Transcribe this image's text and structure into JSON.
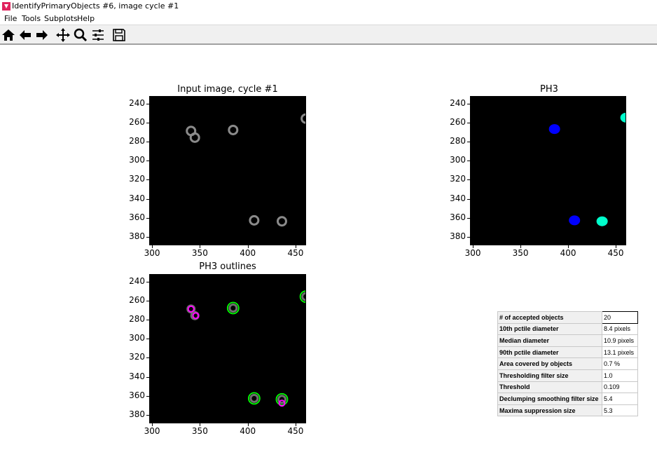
{
  "window": {
    "title": "IdentifyPrimaryObjects #6, image cycle #1"
  },
  "menu": [
    "File",
    "Tools",
    "Subplots",
    "Help"
  ],
  "toolbar": [
    {
      "name": "home-icon"
    },
    {
      "name": "back-arrow-icon"
    },
    {
      "name": "forward-arrow-icon"
    },
    {
      "name": "pan-icon"
    },
    {
      "name": "zoom-icon"
    },
    {
      "name": "configure-subplots-icon"
    },
    {
      "name": "save-icon"
    }
  ],
  "plots": [
    {
      "id": "input",
      "title": "Input image, cycle #1"
    },
    {
      "id": "ph3",
      "title": "PH3"
    },
    {
      "id": "outlines",
      "title": "PH3 outlines"
    }
  ],
  "axes": {
    "xticks": [
      "300",
      "350",
      "400",
      "450"
    ],
    "yticks": [
      "240",
      "260",
      "280",
      "300",
      "320",
      "340",
      "360",
      "380"
    ],
    "xlim": [
      297,
      461
    ],
    "ylim": [
      389,
      232
    ]
  },
  "objects": {
    "gray_cells": [
      {
        "x": 340,
        "y": 268
      },
      {
        "x": 344,
        "y": 275
      },
      {
        "x": 384,
        "y": 267
      },
      {
        "x": 406,
        "y": 362
      },
      {
        "x": 435,
        "y": 363
      },
      {
        "x": 460,
        "y": 255
      }
    ],
    "ph3_labels": [
      {
        "x": 385,
        "y": 266,
        "color": "#0000ff"
      },
      {
        "x": 406,
        "y": 362,
        "color": "#0000ff"
      },
      {
        "x": 435,
        "y": 363,
        "color": "#00ffcc"
      },
      {
        "x": 460,
        "y": 254,
        "color": "#00ffcc"
      }
    ],
    "outlines_green": [
      {
        "x": 384,
        "y": 267
      },
      {
        "x": 406,
        "y": 362
      },
      {
        "x": 435,
        "y": 363
      },
      {
        "x": 460,
        "y": 255
      }
    ],
    "outlines_magenta": [
      {
        "x": 340,
        "y": 268
      },
      {
        "x": 345,
        "y": 275
      },
      {
        "x": 435,
        "y": 367
      }
    ]
  },
  "stats": [
    {
      "label": "# of accepted objects",
      "value": "20"
    },
    {
      "label": "10th pctile diameter",
      "value": "8.4 pixels"
    },
    {
      "label": "Median diameter",
      "value": "10.9 pixels"
    },
    {
      "label": "90th pctile diameter",
      "value": "13.1 pixels"
    },
    {
      "label": "Area covered by objects",
      "value": "0.7 %"
    },
    {
      "label": "Thresholding filter size",
      "value": "1.0"
    },
    {
      "label": "Threshold",
      "value": "0.109"
    },
    {
      "label": "Declumping smoothing filter size",
      "value": "5.4"
    },
    {
      "label": "Maxima suppression size",
      "value": "5.3"
    }
  ]
}
